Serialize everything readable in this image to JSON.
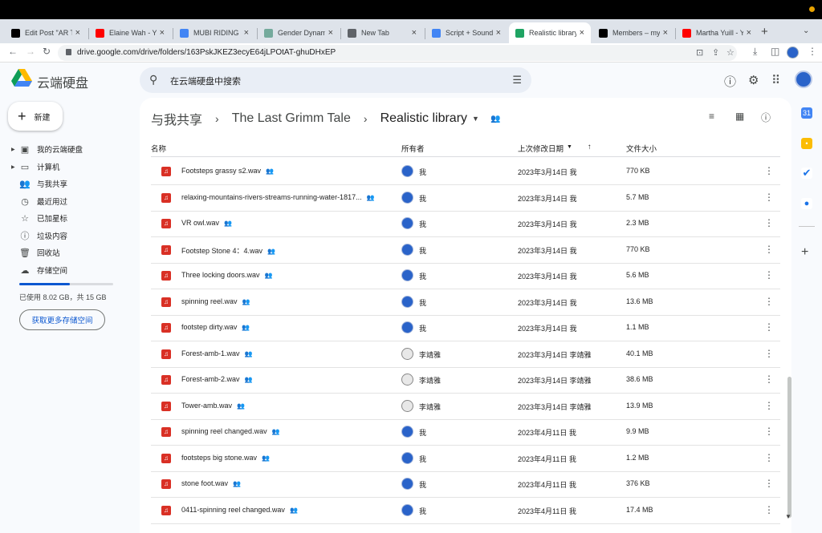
{
  "browser": {
    "tabs": [
      {
        "title": "Edit Post \"AR Ti",
        "favicon": "medium-icon",
        "color": "#000000"
      },
      {
        "title": "Elaine Wah - Yo",
        "favicon": "youtube-icon",
        "color": "#ff0000"
      },
      {
        "title": "MUBI RIDING H",
        "favicon": "google-icon",
        "color": "#4285f4"
      },
      {
        "title": "Gender Dynami",
        "favicon": "chatgpt-icon",
        "color": "#74aa9c"
      },
      {
        "title": "New Tab",
        "favicon": "chrome-icon",
        "color": "#5f6368"
      },
      {
        "title": "Script + Soundd",
        "favicon": "docs-icon",
        "color": "#4285f4"
      },
      {
        "title": "Realistic library",
        "favicon": "drive-icon",
        "color": "#1fa463",
        "active": true
      },
      {
        "title": "Members – myt",
        "favicon": "medium-icon",
        "color": "#000000"
      },
      {
        "title": "Martha Yuill - Yo",
        "favicon": "youtube-icon",
        "color": "#ff0000"
      }
    ],
    "new_tab": "+",
    "url": "drive.google.com/drive/folders/163PskJKEZ3ecyE64jLPOtAT-ghuDHxEP"
  },
  "drive": {
    "brand": "云端硬盘",
    "search_placeholder": "在云端硬盘中搜索",
    "new_label": "新建",
    "sidebar": [
      {
        "label": "我的云端硬盘",
        "icon": "my-drive-icon",
        "glyph": "▣",
        "caret": true
      },
      {
        "label": "计算机",
        "icon": "computer-icon",
        "glyph": "▭",
        "caret": true
      },
      {
        "label": "与我共享",
        "icon": "shared-icon",
        "glyph": "👥",
        "caret": false
      },
      {
        "label": "最近用过",
        "icon": "clock-icon",
        "glyph": "◷",
        "caret": false
      },
      {
        "label": "已加星标",
        "icon": "star-icon",
        "glyph": "☆",
        "caret": false
      },
      {
        "label": "垃圾内容",
        "icon": "spam-icon",
        "glyph": "ⓘ",
        "caret": false
      },
      {
        "label": "回收站",
        "icon": "trash-icon",
        "glyph": "🗑",
        "caret": false
      },
      {
        "label": "存储空间",
        "icon": "cloud-icon",
        "glyph": "☁",
        "caret": false
      }
    ],
    "storage": {
      "text": "已使用 8.02 GB，共 15 GB",
      "fraction": 0.535,
      "button": "获取更多存储空间"
    },
    "breadcrumb": [
      "与我共享",
      "The Last Grimm Tale",
      "Realistic library"
    ],
    "columns": {
      "name": "名称",
      "owner": "所有者",
      "modified": "上次修改日期",
      "size": "文件大小"
    },
    "files": [
      {
        "name": "Footsteps grassy s2.wav",
        "owner": "我",
        "modified": "2023年3月14日 我",
        "size": "770 KB",
        "alt": false
      },
      {
        "name": "relaxing-mountains-rivers-streams-running-water-1817...",
        "owner": "我",
        "modified": "2023年3月14日 我",
        "size": "5.7 MB",
        "alt": false
      },
      {
        "name": "VR owl.wav",
        "owner": "我",
        "modified": "2023年3月14日 我",
        "size": "2.3 MB",
        "alt": false
      },
      {
        "name": "Footstep Stone 4：4.wav",
        "owner": "我",
        "modified": "2023年3月14日 我",
        "size": "770 KB",
        "alt": false
      },
      {
        "name": "Three locking doors.wav",
        "owner": "我",
        "modified": "2023年3月14日 我",
        "size": "5.6 MB",
        "alt": false
      },
      {
        "name": "spinning reel.wav",
        "owner": "我",
        "modified": "2023年3月14日 我",
        "size": "13.6 MB",
        "alt": false
      },
      {
        "name": "footstep dirty.wav",
        "owner": "我",
        "modified": "2023年3月14日 我",
        "size": "1.1 MB",
        "alt": false
      },
      {
        "name": "Forest-amb-1.wav",
        "owner": "李靖雅",
        "modified": "2023年3月14日 李靖雅",
        "size": "40.1 MB",
        "alt": true
      },
      {
        "name": "Forest-amb-2.wav",
        "owner": "李靖雅",
        "modified": "2023年3月14日 李靖雅",
        "size": "38.6 MB",
        "alt": true
      },
      {
        "name": "Tower-amb.wav",
        "owner": "李靖雅",
        "modified": "2023年3月14日 李靖雅",
        "size": "13.9 MB",
        "alt": true
      },
      {
        "name": "spinning reel changed.wav",
        "owner": "我",
        "modified": "2023年4月11日 我",
        "size": "9.9 MB",
        "alt": false
      },
      {
        "name": "footsteps big stone.wav",
        "owner": "我",
        "modified": "2023年4月11日 我",
        "size": "1.2 MB",
        "alt": false
      },
      {
        "name": "stone foot.wav",
        "owner": "我",
        "modified": "2023年4月11日 我",
        "size": "376 KB",
        "alt": false
      },
      {
        "name": "0411-spinning reel changed.wav",
        "owner": "我",
        "modified": "2023年4月11日 我",
        "size": "17.4 MB",
        "alt": false
      }
    ]
  }
}
